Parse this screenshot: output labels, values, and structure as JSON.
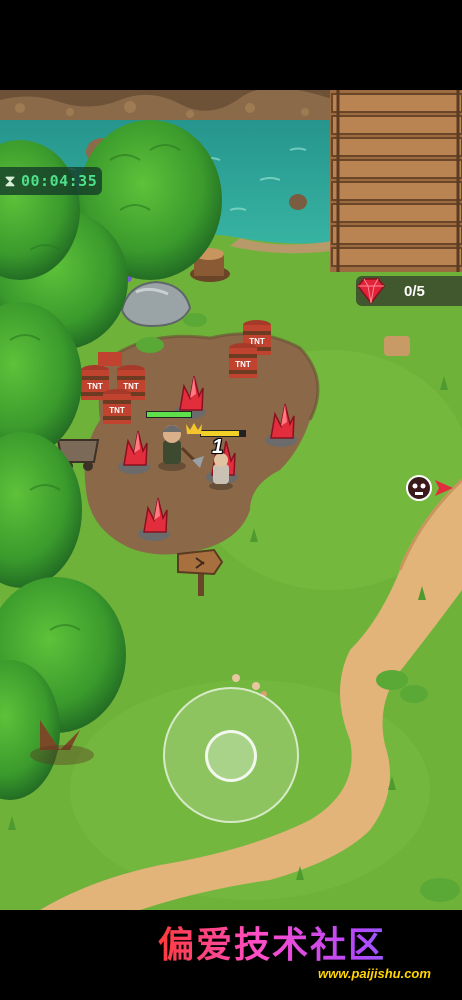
{
  "hud": {
    "timer": "00:04:35",
    "timer_icon": "hourglass-icon",
    "gem_counter": "0/5",
    "gem_icon": "red-gem-icon",
    "enemy_pointer_icon": "skull-pointer-icon"
  },
  "combat": {
    "damage_number": "1"
  },
  "props": {
    "barrel_label": "TNT"
  },
  "watermark": {
    "title": "偏爱技术社区",
    "url": "www.paijishu.com"
  },
  "colors": {
    "grass": "#6fb23a",
    "water": "#2fa89a",
    "timer_text": "#4ee08a",
    "gem": "#e2233a"
  }
}
